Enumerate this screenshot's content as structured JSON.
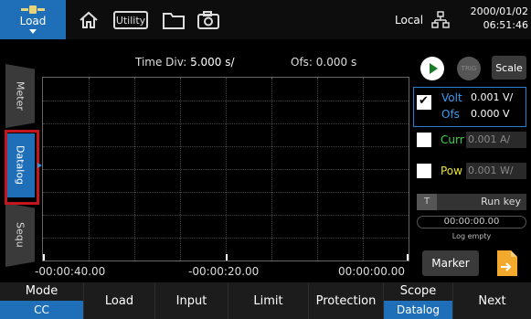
{
  "colors": {
    "accent": "#1f6fb8",
    "highlight": "#c4141c",
    "volt": "#3a9bf0",
    "curr": "#3cd34a",
    "pow": "#e8e337"
  },
  "topbar": {
    "load_label": "Load",
    "utility_label": "Utility",
    "local_label": "Local",
    "date": "2000/01/02",
    "time": "06:51:46",
    "icons": [
      "battery-icon",
      "home-icon",
      "utility-icon",
      "folder-icon",
      "camera-icon",
      "network-icon"
    ]
  },
  "side_tabs": {
    "meter": "Meter",
    "datalog": "Datalog",
    "sequ": "Sequ"
  },
  "plot": {
    "time_div_label": "Time Div:",
    "time_div_value": "5.000 s/",
    "ofs_label": "Ofs:",
    "ofs_value": "0.000 s",
    "x_labels": [
      "-00:00:40.00",
      "-00:00:20.00",
      "00:00:00.00"
    ]
  },
  "right_panel": {
    "trig_label": "TRIG",
    "scale_label": "Scale",
    "volt": {
      "checked": true,
      "label": "Volt",
      "value": "0.001 V/",
      "ofs_label": "Ofs",
      "ofs_value": "0.000 V"
    },
    "curr": {
      "checked": false,
      "label": "Curr",
      "value": "0.001 A/"
    },
    "pow": {
      "checked": false,
      "label": "Pow",
      "value": "0.001 W/"
    },
    "runkey_tag": "T",
    "runkey_label": "Run key",
    "timer": "00:00:00.00",
    "log_status": "Log empty",
    "marker_label": "Marker"
  },
  "bottombar": {
    "mode_label": "Mode",
    "mode_value": "CC",
    "load": "Load",
    "input": "Input",
    "limit": "Limit",
    "protection": "Protection",
    "scope_label": "Scope",
    "scope_value": "Datalog",
    "next": "Next"
  }
}
